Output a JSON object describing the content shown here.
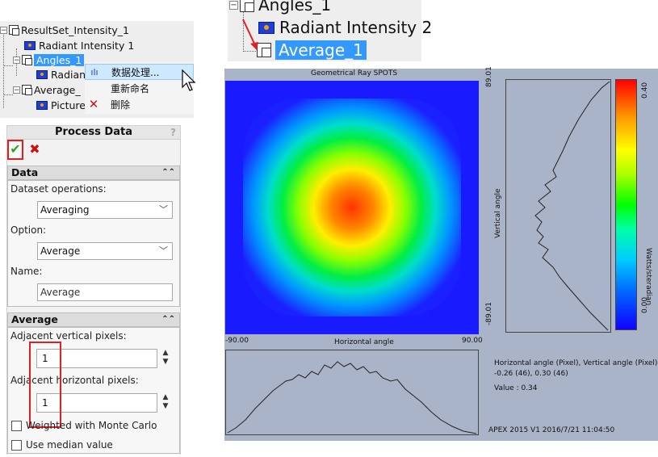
{
  "tree1": {
    "resultset": "ResultSet_Intensity_1",
    "radiant1": "Radiant Intensity 1",
    "angles": "Angles_1",
    "radian_child": "Radian",
    "average": "Average_",
    "picture": "Picture"
  },
  "context_menu": {
    "process_data": "数据处理...",
    "rename": "重新命名",
    "delete": "删除"
  },
  "process_data": {
    "title": "Process Data",
    "help": "?",
    "ok": "✔",
    "cancel": "✖",
    "data_section": {
      "header": "Data",
      "dataset_operations_label": "Dataset operations:",
      "dataset_operations_value": "Averaging",
      "option_label": "Option:",
      "option_value": "Average",
      "name_label": "Name:",
      "name_value": "Average"
    },
    "average_section": {
      "header": "Average",
      "vertical_label": "Adjacent vertical pixels:",
      "vertical_value": "1",
      "horizontal_label": "Adjacent horizontal pixels:",
      "horizontal_value": "1",
      "weighted_label": "Weighted with Monte Carlo",
      "median_label": "Use median value"
    }
  },
  "tree2": {
    "angles": "Angles_1",
    "radiant2": "Radiant Intensity 2",
    "average": "Average_1"
  },
  "viewer": {
    "title": "Geometrical Ray SPOTS",
    "v_max": "89.01",
    "v_min": "-89.01",
    "v_label": "Vertical angle",
    "h_min": "-90.00",
    "h_max": "90.00",
    "h_label": "Horizontal angle",
    "cb_max": "0.40",
    "cb_min": "0.00",
    "cb_unit": "Watts/steradian",
    "info_line1": "Horizontal angle (Pixel), Vertical angle (Pixel):",
    "info_line2": "-0.26 (46),  0.30 (46)",
    "info_value": "Value : 0.34",
    "footer": "APEX 2015 V1 2016/7/21 11:04:50"
  },
  "colors": {
    "selection": "#3399ff",
    "highlight_red": "#e02020",
    "viewer_bg": "#aab4c8"
  }
}
